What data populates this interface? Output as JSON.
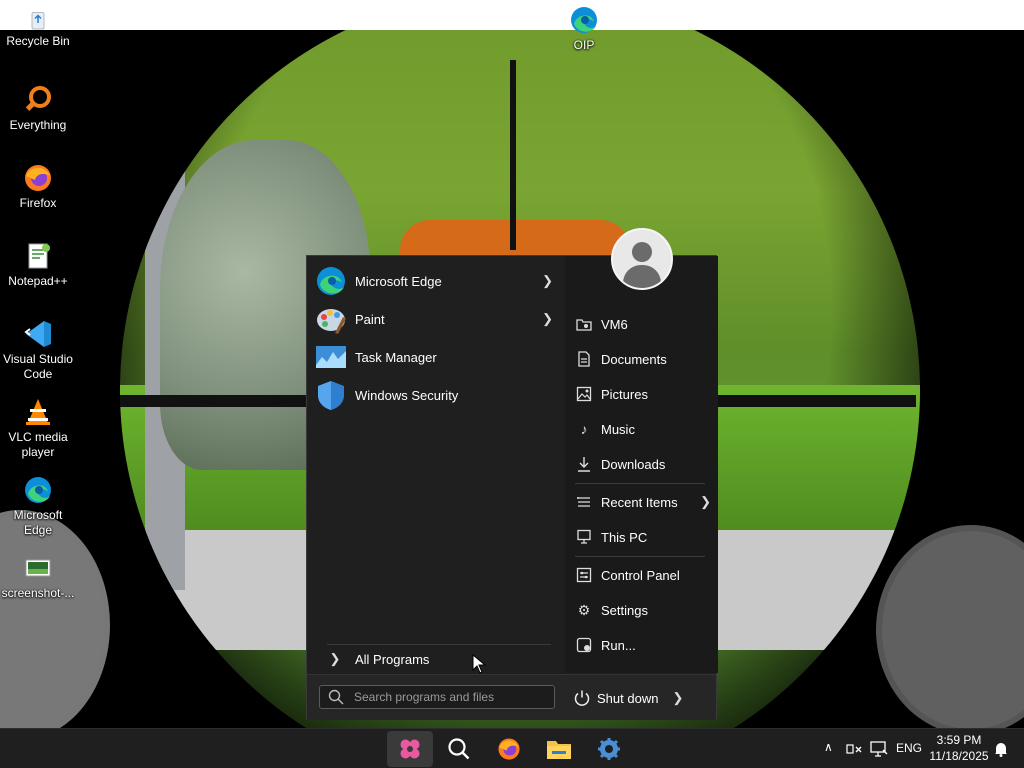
{
  "desktop": {
    "icons": [
      {
        "label": "Recycle Bin",
        "icon": "recycle-bin-icon"
      },
      {
        "label": "Everything",
        "icon": "everything-icon"
      },
      {
        "label": "Firefox",
        "icon": "firefox-icon"
      },
      {
        "label": "Notepad++",
        "icon": "notepad-plus-plus-icon"
      },
      {
        "label": "Visual Studio Code",
        "icon": "vscode-icon"
      },
      {
        "label": "VLC media player",
        "icon": "vlc-icon"
      },
      {
        "label": "Microsoft Edge",
        "icon": "edge-icon"
      },
      {
        "label": "screenshot-...",
        "icon": "image-file-icon"
      },
      {
        "label": "OIP",
        "icon": "edge-icon"
      }
    ]
  },
  "start_menu": {
    "pinned": [
      {
        "label": "Microsoft Edge",
        "icon": "edge-icon",
        "has_submenu": true
      },
      {
        "label": "Paint",
        "icon": "paint-icon",
        "has_submenu": true
      },
      {
        "label": "Task Manager",
        "icon": "task-manager-icon",
        "has_submenu": false
      },
      {
        "label": "Windows Security",
        "icon": "shield-icon",
        "has_submenu": false
      }
    ],
    "all_programs": "All Programs",
    "right": [
      {
        "label": "VM6",
        "icon": "user-folder-icon"
      },
      {
        "label": "Documents",
        "icon": "document-icon"
      },
      {
        "label": "Pictures",
        "icon": "picture-icon"
      },
      {
        "label": "Music",
        "icon": "music-icon"
      },
      {
        "label": "Downloads",
        "icon": "download-icon"
      },
      {
        "label": "Recent Items",
        "icon": "recent-icon",
        "has_submenu": true
      },
      {
        "label": "This PC",
        "icon": "computer-icon"
      },
      {
        "label": "Control Panel",
        "icon": "control-panel-icon"
      },
      {
        "label": "Settings",
        "icon": "gear-icon"
      },
      {
        "label": "Run...",
        "icon": "run-icon"
      }
    ],
    "search_placeholder": "Search programs and files",
    "shutdown_label": "Shut down"
  },
  "taskbar": {
    "apps": [
      "start-icon",
      "search-icon",
      "firefox-icon",
      "file-explorer-icon",
      "settings-icon"
    ],
    "tray": {
      "language": "ENG",
      "time": "3:59 PM",
      "date": "11/18/2025"
    }
  },
  "colors": {
    "menu_bg": "#1f1f1f",
    "taskbar_bg": "#1f1f1f",
    "start_accent": "#e85aa0"
  }
}
